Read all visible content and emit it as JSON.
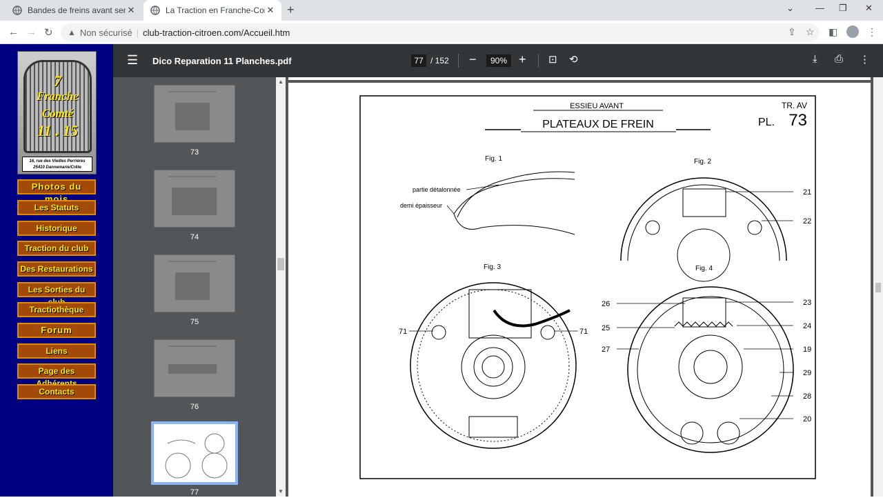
{
  "browser": {
    "tabs": [
      {
        "title": "Bandes de freins avant sens de m",
        "active": false
      },
      {
        "title": "La Traction en Franche-Comté",
        "active": true
      }
    ],
    "address": {
      "security": "Non sécurisé",
      "url": "club-traction-citroen.com/Accueil.htm"
    }
  },
  "site": {
    "logo": {
      "line1": "7",
      "line2": "Franche",
      "line3": "Comté",
      "line4": "11 . 15",
      "address_line1": "16, rue des Vieilles Perrières",
      "address_line2": "25410 Dannemarie/Crête"
    },
    "menu": [
      "Photos du mois",
      "Les Statuts",
      "Historique",
      "Traction du club",
      "Des Restaurations",
      "Les Sorties du club",
      "Tractiothèque",
      "Forum",
      "Liens",
      "Page des Adhérents",
      "Contacts"
    ]
  },
  "pdf": {
    "filename": "Dico Reparation 11 Planches.pdf",
    "page_current": "77",
    "page_total": "/ 152",
    "zoom": "90%",
    "thumbnails": [
      "73",
      "74",
      "75",
      "76",
      "77"
    ],
    "selected_thumbnail": "77"
  },
  "drawing": {
    "section": "ESSIEU AVANT",
    "title": "PLATEAUX DE FREIN",
    "code": "TR. AV",
    "plate_prefix": "PL.",
    "plate_number": "73",
    "fig1": "Fig. 1",
    "fig2": "Fig. 2",
    "fig3": "Fig. 3",
    "fig4": "Fig. 4",
    "label_partie": "partie détalonnée",
    "label_demi": "demi épaisseur",
    "callouts": [
      "21",
      "22",
      "71",
      "71",
      "26",
      "23",
      "25",
      "24",
      "27",
      "19",
      "29",
      "28",
      "20"
    ]
  }
}
